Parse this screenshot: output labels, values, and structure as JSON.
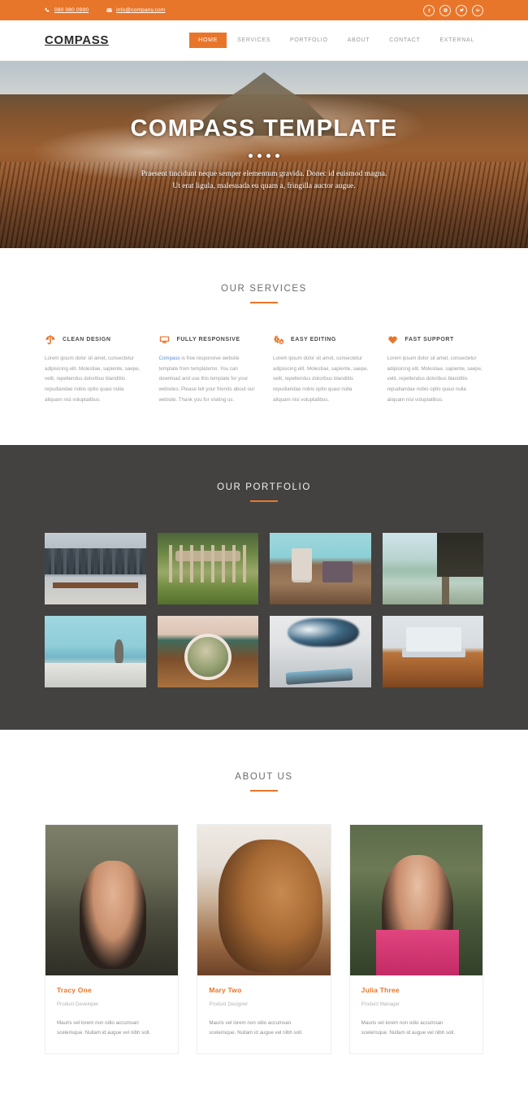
{
  "topbar": {
    "phone": "080 080 0990",
    "email": "info@company.com",
    "phone_icon": "phone-icon",
    "email_icon": "envelope-icon",
    "socials": [
      {
        "name": "facebook",
        "glyph": "f"
      },
      {
        "name": "instagram",
        "glyph": "▣"
      },
      {
        "name": "twitter",
        "glyph": "t"
      },
      {
        "name": "google-plus",
        "glyph": "g"
      }
    ]
  },
  "header": {
    "logo": "COMPASS",
    "nav": [
      {
        "label": "HOME",
        "active": true
      },
      {
        "label": "SERVICES",
        "active": false
      },
      {
        "label": "PORTFOLIO",
        "active": false
      },
      {
        "label": "ABOUT",
        "active": false
      },
      {
        "label": "CONTACT",
        "active": false
      },
      {
        "label": "EXTERNAL",
        "active": false
      }
    ]
  },
  "hero": {
    "title": "COMPASS TEMPLATE",
    "subtitle_line1": "Praesent tincidunt neque semper elementum gravida. Donec id euismod magna.",
    "subtitle_line2": "Ut erat ligula, malesuada eu quam a, fringilla auctor augue.",
    "dots": 4,
    "active_dot": 0,
    "image_alt": "mount-bromo-volcano-landscape"
  },
  "services": {
    "heading": "OUR SERVICES",
    "items": [
      {
        "icon": "umbrella-icon",
        "title": "CLEAN DESIGN",
        "body": "Lorem ipsum dolor sit amet, consectetur adipisicing elit. Molestiae, sapiente, saepe, velit, repellendus doloribus blanditiis repudiandae nobis optio quasi nulla aliquam nisi voluptatibus.",
        "link_text": null
      },
      {
        "icon": "desktop-icon",
        "title": "FULLY RESPONSIVE",
        "body": " is free responsive website template from templatemo. You can download and use this template for your websites. Please tell your friends about our website. Thank you for visiting us.",
        "link_text": "Compass"
      },
      {
        "icon": "cogs-icon",
        "title": "EASY EDITING",
        "body": "Lorem ipsum dolor sit amet, consectetur adipisicing elit. Molestiae, sapiente, saepe, velit, repellendus doloribus blanditiis repudiandae nobis optio quasi nulla aliquam nisi voluptatibus.",
        "link_text": null
      },
      {
        "icon": "heart-icon",
        "title": "FAST SUPPORT",
        "body": "Lorem ipsum dolor sit amet, consectetur adipisicing elit. Molestiae, sapiente, saepe, velit, repellendus doloribus blanditiis repudiandae nobis optio quasi nulla aliquam nisi voluptatibus.",
        "link_text": null
      }
    ]
  },
  "portfolio": {
    "heading": "OUR PORTFOLIO",
    "items": [
      {
        "alt": "city-skyline-bench-waterfront",
        "art": "art-city"
      },
      {
        "alt": "wooden-dock-posts-grass",
        "art": "art-dock"
      },
      {
        "alt": "coffee-cup-pastry-box-table",
        "art": "art-coffee"
      },
      {
        "alt": "bridge-pier-over-lake",
        "art": "art-bridge"
      },
      {
        "alt": "pelican-on-pier-posts",
        "art": "art-pelican"
      },
      {
        "alt": "cactus-in-white-pot",
        "art": "art-cactus"
      },
      {
        "alt": "smartphone-close-up-blur",
        "art": "art-phone"
      },
      {
        "alt": "laptop-glasses-mouse-desk",
        "art": "art-desk"
      }
    ]
  },
  "about": {
    "heading": "ABOUT US",
    "team": [
      {
        "name": "Tracy One",
        "role": "Product Developer",
        "desc": "Mauris vel lorem non odio accumsan scelerisque. Nullam id augue vel nibh soll.",
        "photo_alt": "portrait-woman-dark-hair",
        "art": "art-tracy"
      },
      {
        "name": "Mary Two",
        "role": "Product Designer",
        "desc": "Mauris vel lorem non odio accumsan scelerisque. Nullam id augue vel nibh soll.",
        "photo_alt": "portrait-woman-auburn-hair",
        "art": "art-mary"
      },
      {
        "name": "Julia Three",
        "role": "Product Manager",
        "desc": "Mauris vel lorem non odio accumsan scelerisque. Nullam id augue vel nibh soll.",
        "photo_alt": "portrait-woman-pink-dress-forest",
        "art": "art-julia"
      }
    ]
  },
  "colors": {
    "accent": "#e8762a",
    "dark_section": "#434240",
    "link_blue": "#5b8fd0",
    "body_text": "#9b9b9b",
    "heading_text": "#6b6b6b"
  }
}
